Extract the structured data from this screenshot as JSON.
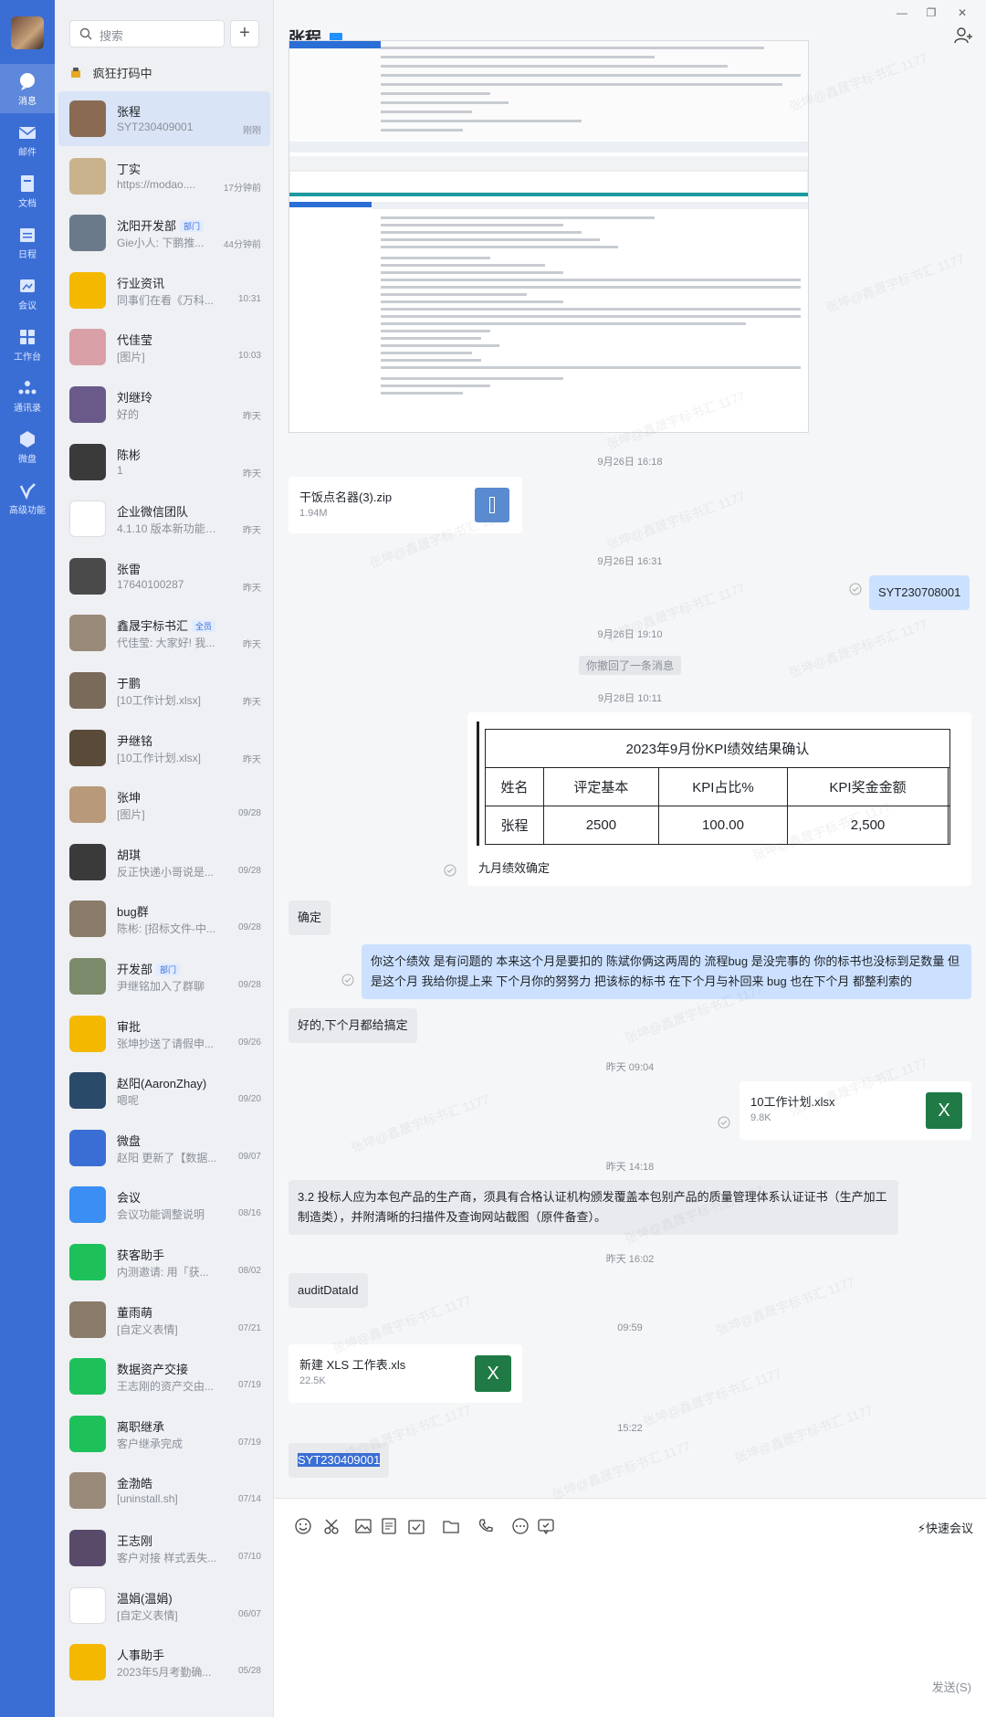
{
  "rail": {
    "items": [
      {
        "label": "消息",
        "icon": "chat-icon"
      },
      {
        "label": "邮件",
        "icon": "mail-icon"
      },
      {
        "label": "文档",
        "icon": "doc-icon"
      },
      {
        "label": "日程",
        "icon": "calendar-icon"
      },
      {
        "label": "会议",
        "icon": "meeting-icon"
      },
      {
        "label": "工作台",
        "icon": "grid-icon"
      },
      {
        "label": "通讯录",
        "icon": "contacts-icon"
      },
      {
        "label": "微盘",
        "icon": "drive-icon"
      },
      {
        "label": "高级功能",
        "icon": "advanced-icon"
      }
    ]
  },
  "search": {
    "placeholder": "搜索"
  },
  "status": {
    "text": "疯狂打码中"
  },
  "conversations": [
    {
      "name": "张程",
      "preview": "SYT230409001",
      "time": "刚刚",
      "avatar_color": "#8a6a52",
      "active": true
    },
    {
      "name": "丁实",
      "preview": "https://modao....",
      "time": "17分钟前",
      "avatar_color": "#c9b38d"
    },
    {
      "name": "沈阳开发部",
      "tag": "部门",
      "preview": "Gie小人: 下鹏推...",
      "time": "44分钟前",
      "avatar_color": "#6b7a8a"
    },
    {
      "name": "行业资讯",
      "preview": "同事们在看《万科...",
      "time": "10:31",
      "avatar_color": "#f5b800"
    },
    {
      "name": "代佳莹",
      "preview": "[图片]",
      "time": "10:03",
      "avatar_color": "#d9a0a8"
    },
    {
      "name": "刘继玲",
      "preview": "好的",
      "time": "昨天",
      "avatar_color": "#6a5a8a"
    },
    {
      "name": "陈彬",
      "preview": "1",
      "time": "昨天",
      "avatar_color": "#3a3a3a"
    },
    {
      "name": "企业微信团队",
      "preview": "4.1.10 版本新功能介绍",
      "time": "昨天",
      "avatar_color": "#ffffff"
    },
    {
      "name": "张雷",
      "preview": "17640100287",
      "time": "昨天",
      "avatar_color": "#4a4a4a"
    },
    {
      "name": "鑫晟宇标书汇",
      "tag": "全员",
      "preview": "代佳莹: 大家好! 我...",
      "time": "昨天",
      "avatar_color": "#9a8a7a"
    },
    {
      "name": "于鹏",
      "preview": "[10工作计划.xlsx]",
      "time": "昨天",
      "avatar_color": "#7a6a5a"
    },
    {
      "name": "尹继铭",
      "preview": "[10工作计划.xlsx]",
      "time": "昨天",
      "avatar_color": "#5a4a3a"
    },
    {
      "name": "张坤",
      "preview": "[图片]",
      "time": "09/28",
      "avatar_color": "#b89a7a"
    },
    {
      "name": "胡琪",
      "preview": "反正快递小哥说是...",
      "time": "09/28",
      "avatar_color": "#3a3a3a"
    },
    {
      "name": "bug群",
      "preview": "陈彬: [招标文件-中...",
      "time": "09/28",
      "avatar_color": "#8a7a6a"
    },
    {
      "name": "开发部",
      "tag": "部门",
      "preview": "尹继铭加入了群聊",
      "time": "09/28",
      "avatar_color": "#7a8a6a"
    },
    {
      "name": "审批",
      "preview": "张坤抄送了请假申...",
      "time": "09/26",
      "avatar_color": "#f5b800"
    },
    {
      "name": "赵阳(AaronZhay)",
      "preview": "嗯呢",
      "time": "09/20",
      "avatar_color": "#2a4a6a"
    },
    {
      "name": "微盘",
      "preview": "赵阳 更新了【数据...",
      "time": "09/07",
      "avatar_color": "#3b6ed4"
    },
    {
      "name": "会议",
      "preview": "会议功能调整说明",
      "time": "08/16",
      "avatar_color": "#3b8ef4"
    },
    {
      "name": "获客助手",
      "preview": "内测邀请: 用「获...",
      "time": "08/02",
      "avatar_color": "#1ec05a"
    },
    {
      "name": "董雨萌",
      "preview": "[自定义表情]",
      "time": "07/21",
      "avatar_color": "#8a7a6a"
    },
    {
      "name": "数据资产交接",
      "preview": "王志刚的资产交由...",
      "time": "07/19",
      "avatar_color": "#1ec05a"
    },
    {
      "name": "离职继承",
      "preview": "客户继承完成",
      "time": "07/19",
      "avatar_color": "#1ec05a"
    },
    {
      "name": "金渤皓",
      "preview": "[uninstall.sh]",
      "time": "07/14",
      "avatar_color": "#9a8a7a"
    },
    {
      "name": "王志刚",
      "preview": "客户对接 样式丢失...",
      "time": "07/10",
      "avatar_color": "#5a4a6a"
    },
    {
      "name": "温娟(温娟)",
      "preview": "[自定义表情]",
      "time": "06/07",
      "avatar_color": "#ffffff"
    },
    {
      "name": "人事助手",
      "preview": "2023年5月考勤确...",
      "time": "05/28",
      "avatar_color": "#f5b800"
    }
  ],
  "chat": {
    "title": "张程",
    "time_1": "9月26日 16:18",
    "file_1": {
      "name": "干饭点名器(3).zip",
      "size": "1.94M"
    },
    "time_2": "9月26日 16:31",
    "msg_out_1": "SYT230708001",
    "time_3": "9月26日 19:10",
    "recall": "你撤回了一条消息",
    "time_4": "9月28日 10:11",
    "kpi": {
      "title": "2023年9月份KPI绩效结果确认",
      "headers": [
        "姓名",
        "评定基本",
        "KPI占比%",
        "KPI奖金金额"
      ],
      "row": [
        "张程",
        "2500",
        "100.00",
        "2,500"
      ],
      "caption": "九月绩效确定"
    },
    "msg_in_1": "确定",
    "msg_out_2": "你这个绩效 是有问题的 本来这个月是要扣的 陈斌你俩这两周的 流程bug 是没完事的 你的标书也没标到足数量 但是这个月 我给你提上来 下个月你的努努力 把该标的标书 在下个月与补回来 bug 也在下个月 都整利索的",
    "msg_in_2": "好的,下个月都给搞定",
    "time_5": "昨天 09:04",
    "file_2": {
      "name": "10工作计划.xlsx",
      "size": "9.8K"
    },
    "time_6": "昨天 14:18",
    "msg_in_3": "3.2 投标人应为本包产品的生产商，须具有合格认证机构颁发覆盖本包别产品的质量管理体系认证证书（生产加工制造类），并附清晰的扫描件及查询网站截图（原件备查）。",
    "time_7": "昨天 16:02",
    "msg_in_4": "auditDataId",
    "time_8": "09:59",
    "file_3": {
      "name": "新建 XLS 工作表.xls",
      "size": "22.5K"
    },
    "time_9": "15:22",
    "msg_in_5": "SYT230409001"
  },
  "input": {
    "quick_meeting": "快速会议",
    "send": "发送(S)"
  },
  "watermark": "张坤@鑫晟宇标书汇 1177",
  "colors": {
    "rail": "#3b6ed4",
    "out_bubble": "#cce1ff",
    "in_bubble": "#e8eaed",
    "excel": "#1f7a45"
  }
}
